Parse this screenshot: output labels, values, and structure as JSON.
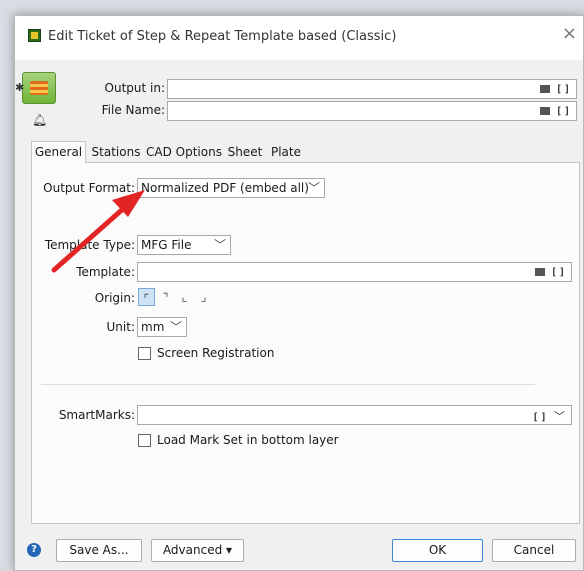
{
  "window": {
    "title": "Edit Ticket of Step & Repeat Template based (Classic)"
  },
  "header": {
    "output_in_label": "Output in:",
    "output_in_value": "",
    "file_name_label": "File Name:",
    "file_name_value": ""
  },
  "tabs": [
    {
      "label": "General",
      "active": true
    },
    {
      "label": "Stations"
    },
    {
      "label": "CAD Options"
    },
    {
      "label": "Sheet"
    },
    {
      "label": "Plate"
    }
  ],
  "general": {
    "output_format_label": "Output Format:",
    "output_format_value": "Normalized PDF (embed all)",
    "template_type_label": "Template Type:",
    "template_type_value": "MFG File",
    "template_label": "Template:",
    "template_value": "",
    "origin_label": "Origin:",
    "unit_label": "Unit:",
    "unit_value": "mm",
    "screen_registration_label": "Screen Registration",
    "screen_registration_checked": false,
    "smartmarks_label": "SmartMarks:",
    "smartmarks_value": "",
    "load_mark_set_label": "Load Mark Set in bottom layer",
    "load_mark_set_checked": false
  },
  "footer": {
    "help_glyph": "?",
    "save_as_label": "Save As...",
    "advanced_label": "Advanced ▾",
    "ok_label": "OK",
    "cancel_label": "Cancel"
  },
  "icons": {
    "close": "×",
    "chevron": "﹀",
    "origin_top_left": "⌐",
    "annotation_arrow_color": "#e32424"
  }
}
